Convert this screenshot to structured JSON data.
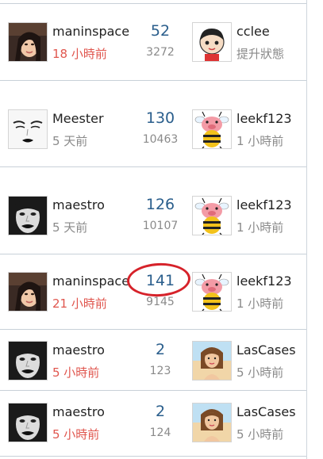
{
  "rows": [
    {
      "author": {
        "name": "maninspace",
        "time": "18 小時前",
        "time_recent": true,
        "avatar_icon": "woman-photo-avatar"
      },
      "replies": "52",
      "views": "3272",
      "last": {
        "name": "cclee",
        "time": "提升狀態",
        "time_recent": false,
        "avatar_icon": "cartoon-boy-avatar"
      }
    },
    {
      "author": {
        "name": "Meester",
        "time": "5 天前",
        "time_recent": false,
        "avatar_icon": "sketch-face-avatar"
      },
      "replies": "130",
      "views": "10463",
      "last": {
        "name": "leekf123",
        "time": "1 小時前",
        "time_recent": false,
        "avatar_icon": "bee-pig-avatar"
      }
    },
    {
      "author": {
        "name": "maestro",
        "time": "5 天前",
        "time_recent": false,
        "avatar_icon": "bw-face-avatar"
      },
      "replies": "126",
      "views": "10107",
      "last": {
        "name": "leekf123",
        "time": "1 小時前",
        "time_recent": false,
        "avatar_icon": "bee-pig-avatar"
      }
    },
    {
      "author": {
        "name": "maninspace",
        "time": "21 小時前",
        "time_recent": true,
        "avatar_icon": "woman-photo-avatar"
      },
      "replies": "141",
      "views": "9145",
      "last": {
        "name": "leekf123",
        "time": "1 小時前",
        "time_recent": false,
        "avatar_icon": "bee-pig-avatar"
      }
    },
    {
      "author": {
        "name": "maestro",
        "time": "5 小時前",
        "time_recent": true,
        "avatar_icon": "bw-face-avatar"
      },
      "replies": "2",
      "views": "123",
      "last": {
        "name": "LasCases",
        "time": "5 小時前",
        "time_recent": false,
        "avatar_icon": "beach-girl-avatar"
      }
    },
    {
      "author": {
        "name": "maestro",
        "time": "5 小時前",
        "time_recent": true,
        "avatar_icon": "bw-face-avatar"
      },
      "replies": "2",
      "views": "124",
      "last": {
        "name": "LasCases",
        "time": "5 小時前",
        "time_recent": false,
        "avatar_icon": "beach-girl-avatar"
      }
    }
  ],
  "colors": {
    "reply_count": "#2a5e8c",
    "recent_time": "#e0564e",
    "muted": "#8a8a8a",
    "highlight_circle": "#d6222a"
  }
}
